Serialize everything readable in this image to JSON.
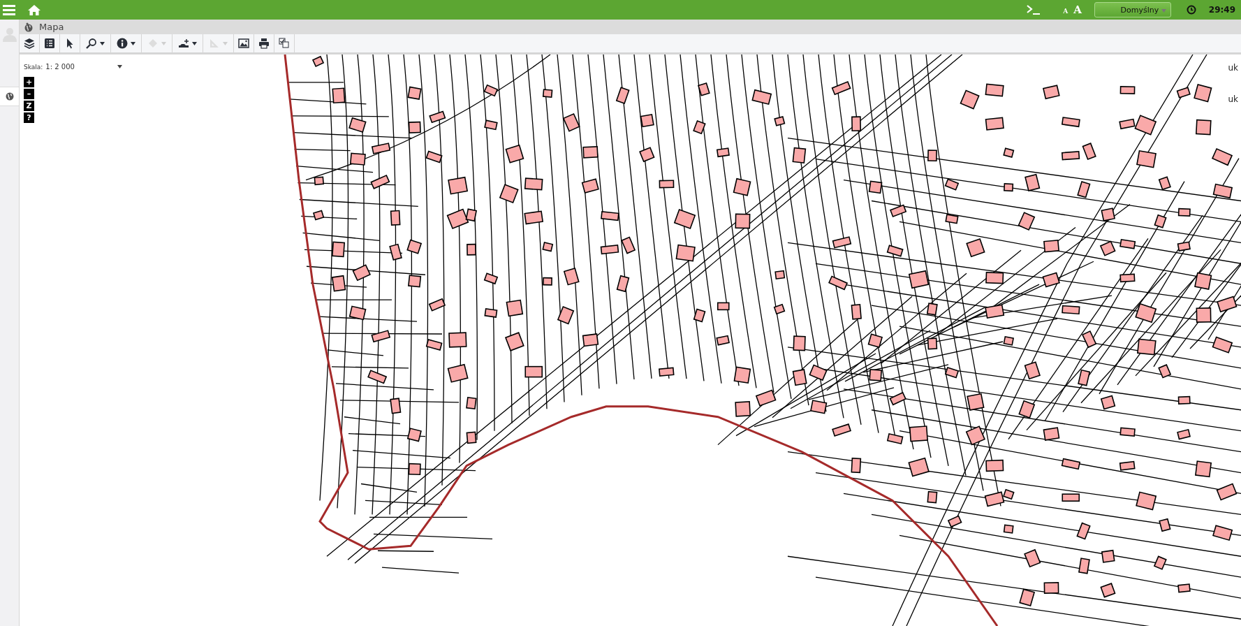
{
  "top_bar": {
    "font_small": "A",
    "font_large": "A",
    "theme": "Domyślny",
    "timer": "29:49"
  },
  "panel": {
    "title": "Mapa"
  },
  "toolbar": [
    {
      "kind": "layers",
      "disabled": false,
      "menu": false
    },
    {
      "kind": "list",
      "disabled": false,
      "menu": false
    },
    {
      "kind": "select",
      "disabled": false,
      "menu": false
    },
    {
      "kind": "zoom",
      "disabled": false,
      "menu": true
    },
    {
      "kind": "info",
      "disabled": false,
      "menu": true
    },
    {
      "kind": "snap",
      "disabled": true,
      "menu": true
    },
    {
      "kind": "edit",
      "disabled": false,
      "menu": true
    },
    {
      "kind": "measure",
      "disabled": true,
      "menu": true
    },
    {
      "kind": "image",
      "disabled": false,
      "menu": false
    },
    {
      "kind": "print",
      "disabled": false,
      "menu": false
    },
    {
      "kind": "toggle",
      "disabled": false,
      "menu": false
    }
  ],
  "scale": {
    "label": "Skala:",
    "value": "1: 2 000"
  },
  "zoom_controls": [
    "+",
    "–",
    "Z",
    "?"
  ],
  "map_labels": [
    "uk",
    "uk"
  ]
}
